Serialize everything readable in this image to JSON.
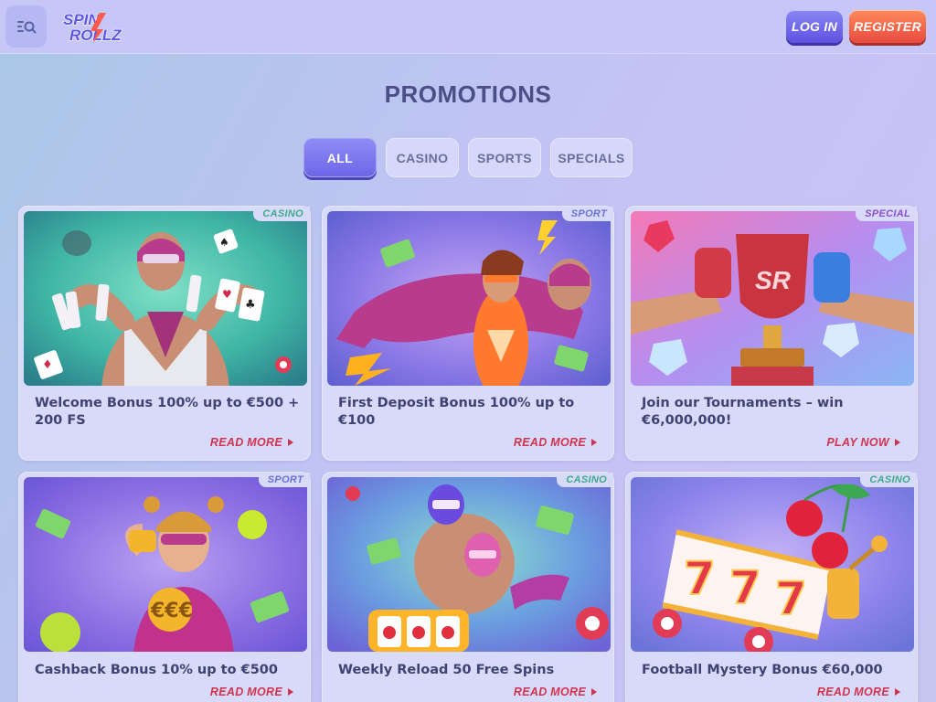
{
  "header": {
    "logo_line1": "SPIN",
    "logo_line2": "ROLLZ",
    "menu_icon": "menu-search-icon",
    "login_label": "LOG IN",
    "register_label": "REGISTER"
  },
  "page": {
    "title": "PROMOTIONS"
  },
  "filters": [
    {
      "label": "ALL",
      "active": true
    },
    {
      "label": "CASINO",
      "active": false
    },
    {
      "label": "SPORTS",
      "active": false
    },
    {
      "label": "SPECIALS",
      "active": false
    }
  ],
  "promotions": [
    {
      "tag": "CASINO",
      "title": "Welcome Bonus 100% up to €500 + 200 FS",
      "cta": "READ MORE",
      "image": "wrestler-with-playing-cards"
    },
    {
      "tag": "SPORT",
      "title": "First Deposit Bonus 100% up to €100",
      "cta": "READ MORE",
      "image": "wrestlers-grappling-with-cash"
    },
    {
      "tag": "SPECIAL",
      "title": "Join our Tournaments – win €6,000,000!",
      "cta": "PLAY NOW",
      "image": "tournament-trophy-with-diamonds"
    },
    {
      "tag": "SPORT",
      "title": "Cashback Bonus 10% up to €500",
      "cta": "READ MORE",
      "image": "female-wrestler-with-tennis-balls"
    },
    {
      "tag": "CASINO",
      "title": "Weekly Reload 50 Free Spins",
      "cta": "READ MORE",
      "image": "wrestlers-on-slot-machine"
    },
    {
      "tag": "CASINO",
      "title": "Football Mystery Bonus €60,000",
      "cta": "READ MORE",
      "image": "777-slot-reels-with-cherries"
    }
  ],
  "colors": {
    "accent": "#6c66e8",
    "register": "#e84a3f",
    "cta": "#d0334f",
    "title": "#4b4f86",
    "tag_casino": "#3daa8a",
    "tag_sport": "#6a72d6",
    "tag_special": "#8a4fd0"
  }
}
